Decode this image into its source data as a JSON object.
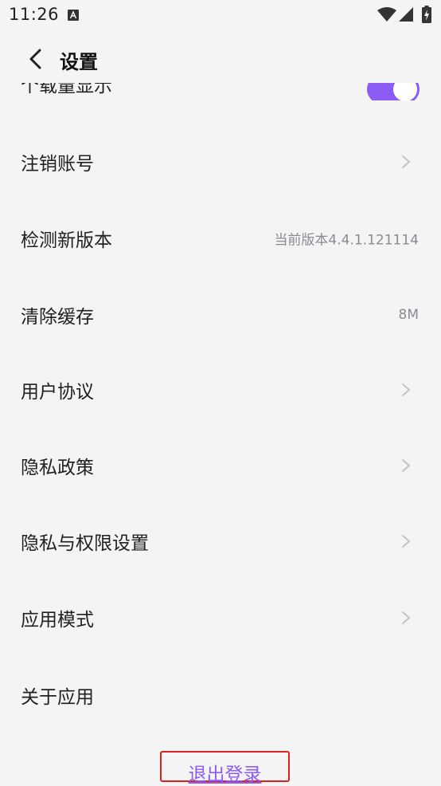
{
  "status_bar": {
    "time": "11:26",
    "icons": [
      "text-a-icon",
      "wifi-icon",
      "signal-icon",
      "battery-charging-icon"
    ]
  },
  "header": {
    "title": "设置",
    "back_icon": "chevron-left-icon"
  },
  "settings": {
    "partial_item": {
      "label": "个载量显示",
      "toggle_on": true
    },
    "items": [
      {
        "label": "注销账号",
        "value": "",
        "chevron": true
      },
      {
        "label": "检测新版本",
        "value": "当前版本4.4.1.121114",
        "chevron": false
      },
      {
        "label": "清除缓存",
        "value": "8M",
        "chevron": false
      },
      {
        "label": "用户协议",
        "value": "",
        "chevron": true
      },
      {
        "label": "隐私政策",
        "value": "",
        "chevron": true
      },
      {
        "label": "隐私与权限设置",
        "value": "",
        "chevron": true
      },
      {
        "label": "应用模式",
        "value": "",
        "chevron": true
      },
      {
        "label": "关于应用",
        "value": "",
        "chevron": false
      }
    ]
  },
  "logout": {
    "label": "退出登录"
  },
  "colors": {
    "accent": "#8b5cf6",
    "background": "#f4f4f5",
    "highlight_border": "#e02020"
  }
}
